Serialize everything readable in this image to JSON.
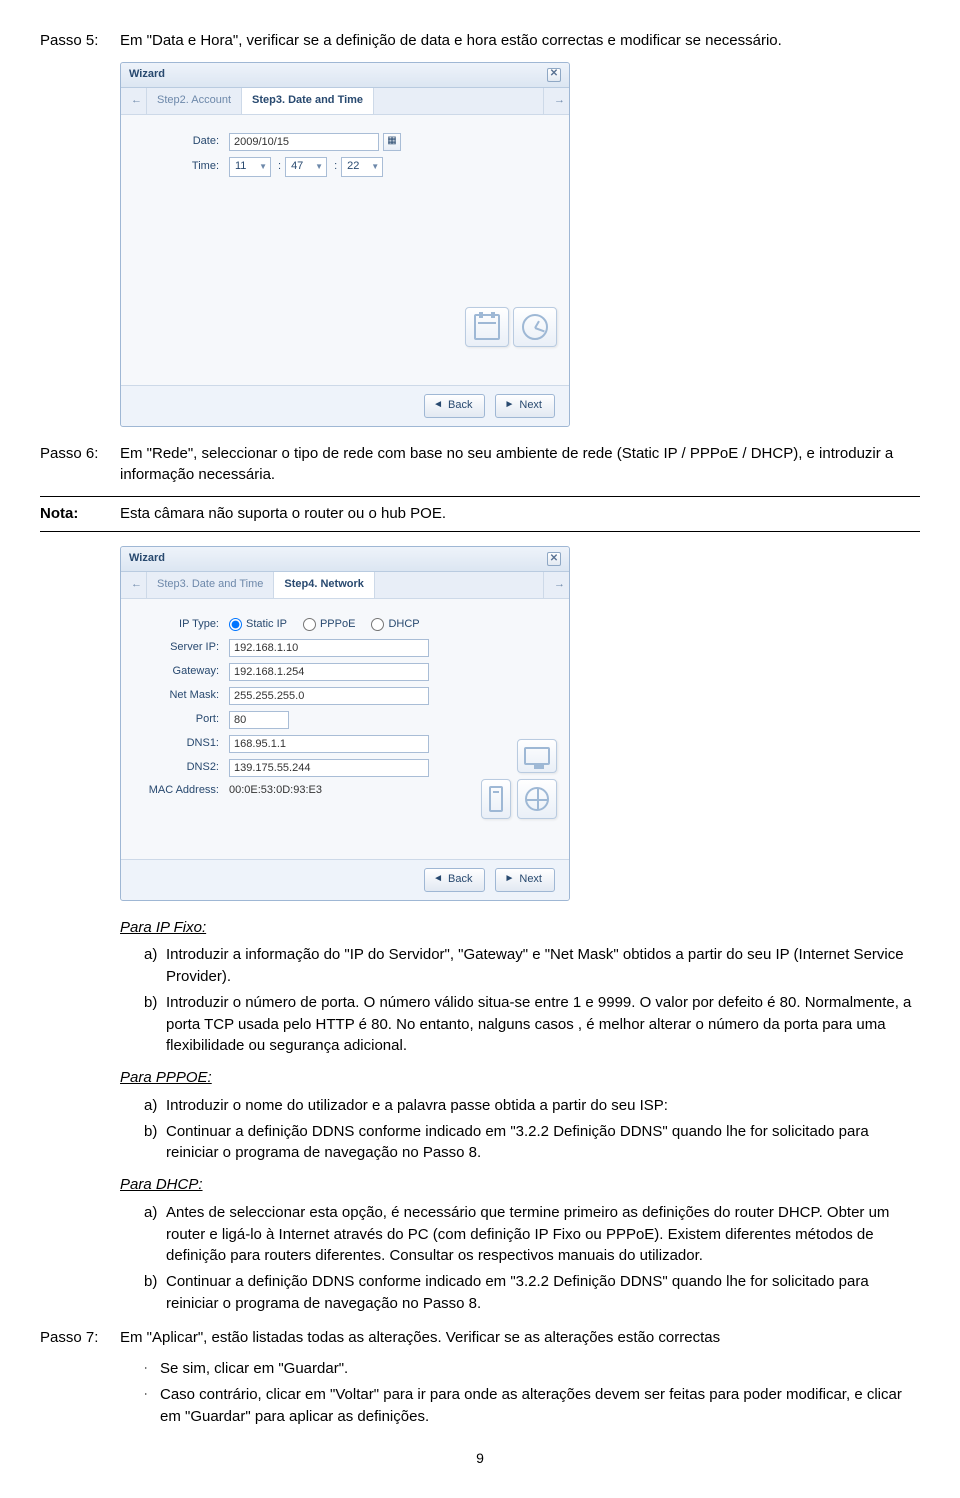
{
  "passo5": {
    "label": "Passo 5:",
    "text": "Em \"Data e Hora\", verificar se a definição de data e hora estão correctas e modificar se necessário."
  },
  "wizard1": {
    "title": "Wizard",
    "prev_tab": "Step2. Account",
    "active_tab": "Step3. Date and Time",
    "date_label": "Date:",
    "date_value": "2009/10/15",
    "time_label": "Time:",
    "time_h": "11",
    "time_m": "47",
    "time_s": "22",
    "back": "Back",
    "next": "Next"
  },
  "passo6": {
    "label": "Passo 6:",
    "text": "Em \"Rede\", seleccionar o tipo de rede com base no seu ambiente de rede (Static IP / PPPoE / DHCP), e introduzir a informação necessária."
  },
  "nota": {
    "label": "Nota:",
    "text": "Esta câmara não suporta o router ou o hub POE."
  },
  "wizard2": {
    "title": "Wizard",
    "prev_tab": "Step3. Date and Time",
    "active_tab": "Step4. Network",
    "iptype_label": "IP Type:",
    "opt_static": "Static IP",
    "opt_pppoe": "PPPoE",
    "opt_dhcp": "DHCP",
    "serverip_label": "Server IP:",
    "serverip": "192.168.1.10",
    "gateway_label": "Gateway:",
    "gateway": "192.168.1.254",
    "netmask_label": "Net Mask:",
    "netmask": "255.255.255.0",
    "port_label": "Port:",
    "port": "80",
    "dns1_label": "DNS1:",
    "dns1": "168.95.1.1",
    "dns2_label": "DNS2:",
    "dns2": "139.175.55.244",
    "mac_label": "MAC Address:",
    "mac": "00:0E:53:0D:93:E3",
    "back": "Back",
    "next": "Next"
  },
  "ipfixo_heading": "Para IP Fixo:",
  "ipfixo_a": "Introduzir a informação do \"IP do Servidor\", \"Gateway\" e \"Net Mask\" obtidos a partir do seu IP (Internet Service Provider).",
  "ipfixo_b": "Introduzir o número de porta. O número válido situa-se entre 1 e 9999. O valor por defeito é 80. Normalmente, a porta TCP usada pelo HTTP é 80. No entanto, nalguns casos , é melhor alterar o número da porta para uma flexibilidade ou segurança adicional.",
  "pppoe_heading": "Para PPPOE:",
  "pppoe_a": "Introduzir o nome do utilizador e a palavra passe obtida a partir do seu ISP:",
  "pppoe_b": "Continuar a definição DDNS conforme indicado em \"3.2.2 Definição DDNS\" quando lhe for solicitado para reiniciar o programa de navegação no Passo 8.",
  "dhcp_heading": "Para DHCP:",
  "dhcp_a": "Antes de seleccionar esta opção, é necessário que termine primeiro as definições do router DHCP. Obter um router e ligá-lo à Internet através do PC (com definição IP Fixo ou PPPoE). Existem diferentes métodos de definição para routers diferentes. Consultar os respectivos manuais do utilizador.",
  "dhcp_b": "Continuar a definição DDNS conforme indicado em \"3.2.2 Definição DDNS\" quando lhe for solicitado para reiniciar o programa de navegação no Passo 8.",
  "passo7": {
    "label": "Passo 7:",
    "text": "Em \"Aplicar\", estão listadas todas as alterações. Verificar se as alterações estão correctas"
  },
  "passo7_b1": "Se sim, clicar em \"Guardar\".",
  "passo7_b2": "Caso contrário, clicar em \"Voltar\" para ir para onde as alterações devem ser feitas para poder modificar, e clicar em \"Guardar\" para aplicar as definições.",
  "pagenum": "9"
}
